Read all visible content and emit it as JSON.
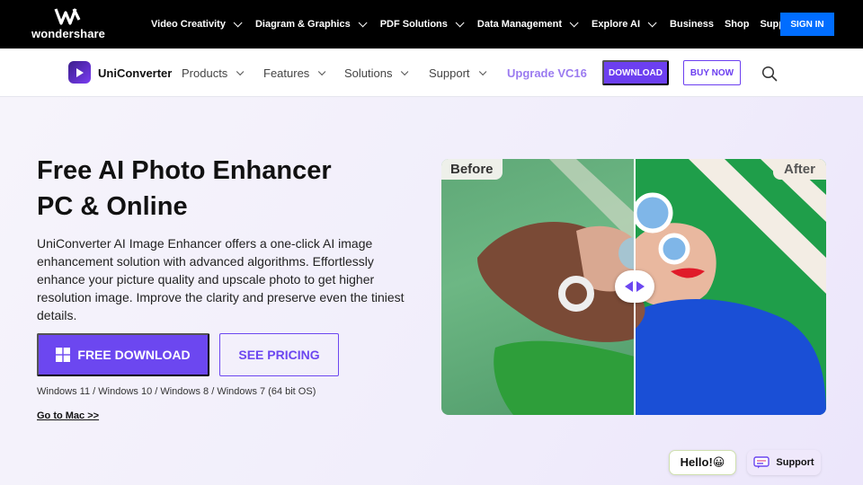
{
  "topbar": {
    "logo_text": "wondershare",
    "nav": [
      {
        "label": "Video Creativity"
      },
      {
        "label": "Diagram & Graphics"
      },
      {
        "label": "PDF Solutions"
      },
      {
        "label": "Data Management"
      },
      {
        "label": "Explore AI"
      }
    ],
    "plain_links": [
      "Business",
      "Shop",
      "Support"
    ],
    "signin_label": "SIGN IN",
    "colors": {
      "background": "#000000",
      "signin": "#006dff"
    }
  },
  "productbar": {
    "product_name": "UniConverter",
    "nav": [
      {
        "label": "Products"
      },
      {
        "label": "Features"
      },
      {
        "label": "Solutions"
      },
      {
        "label": "Support"
      }
    ],
    "upgrade_label": "Upgrade VC16",
    "download_label": "DOWNLOAD",
    "buy_label": "BUY NOW",
    "search_icon": "search-icon",
    "colors": {
      "accent": "#6c3ff0",
      "upgrade": "#9b7bf0"
    }
  },
  "hero": {
    "title_line1": "Free AI Photo Enhancer",
    "title_line2": "PC & Online",
    "description": "UniConverter AI Image Enhancer offers a one-click AI image enhancement solution with advanced algorithms. Effortlessly enhance your picture quality and upscale photo to get higher resolution image. Improve the clarity and preserve even the tiniest details.",
    "free_download_label": "FREE DOWNLOAD",
    "see_pricing_label": "SEE PRICING",
    "os_note": "Windows 11 / Windows 10 / Windows 8 / Windows 7 (64 bit OS)",
    "mac_link": "Go to Mac >>",
    "compare": {
      "before_label": "Before",
      "after_label": "After"
    }
  },
  "chat": {
    "hello_label": "Hello!😀",
    "support_label": "Support"
  }
}
